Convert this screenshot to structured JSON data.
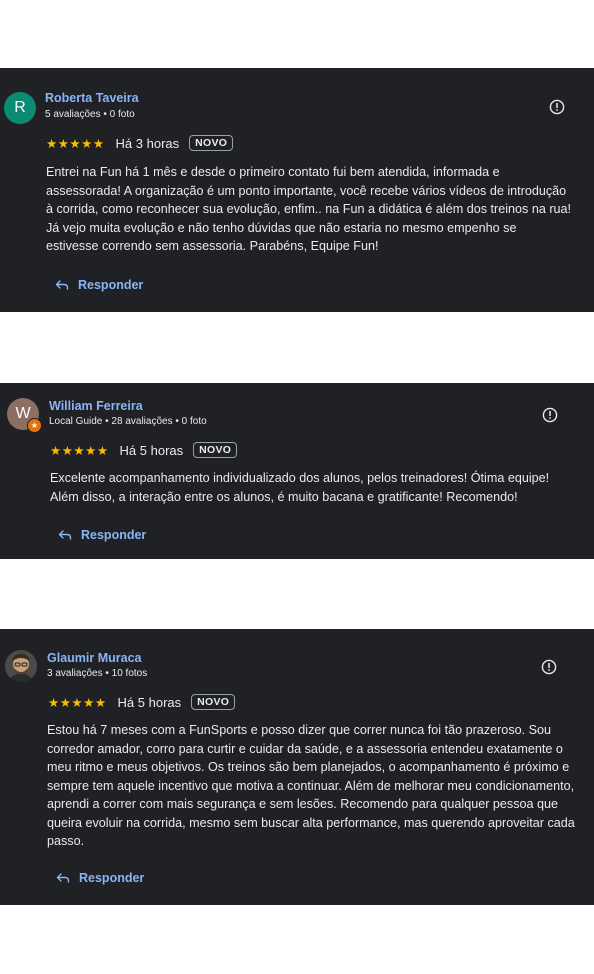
{
  "reviews": [
    {
      "avatar_letter": "R",
      "avatar_color": "#0b8a74",
      "name": "Roberta Taveira",
      "meta": "5 avaliações • 0 foto",
      "stars": "★★★★★",
      "rating": 5,
      "time": "Há 3 horas",
      "badge": "NOVO",
      "text": "Entrei na Fun há 1 mês e desde o primeiro contato fui bem atendida, informada e assessorada! A organização é um ponto importante, você recebe vários vídeos de introdução à corrida, como reconhecer sua evolução, enfim.. na Fun a didática é além dos treinos na rua! Já vejo muita evolução e não tenho dúvidas que não estaria no mesmo empenho se estivesse correndo sem assessoria. Parabéns, Equipe Fun!",
      "reply_label": "Responder"
    },
    {
      "avatar_letter": "W",
      "avatar_color": "#8d6e63",
      "name": "William Ferreira",
      "meta": "Local Guide • 28 avaliações • 0 foto",
      "stars": "★★★★★",
      "rating": 5,
      "time": "Há 5 horas",
      "badge": "NOVO",
      "text": "Excelente acompanhamento individualizado dos alunos, pelos treinadores! Ótima equipe! Além disso, a interação entre os alunos, é muito bacana e gratificante! Recomendo!",
      "reply_label": "Responder"
    },
    {
      "name": "Glaumir Muraca",
      "meta": "3 avaliações • 10 fotos",
      "stars": "★★★★★",
      "rating": 5,
      "time": "Há 5 horas",
      "badge": "NOVO",
      "text": "Estou há 7 meses com a FunSports e posso dizer que correr nunca foi tão prazeroso. Sou corredor amador, corro para curtir e cuidar da saúde, e a assessoria entendeu exatamente o meu ritmo e meus objetivos. Os treinos são bem planejados, o acompanhamento é próximo e sempre tem aquele incentivo que motiva a continuar. Além de melhorar meu condicionamento, aprendi a correr com mais segurança e sem lesões. Recomendo para qualquer pessoa que queira evoluir na corrida, mesmo sem buscar alta performance, mas querendo aproveitar cada passo.",
      "reply_label": "Responder"
    }
  ],
  "colors": {
    "card_bg": "#202124",
    "link": "#8ab4f8",
    "star": "#fbbc04",
    "text": "#e8eaed"
  }
}
